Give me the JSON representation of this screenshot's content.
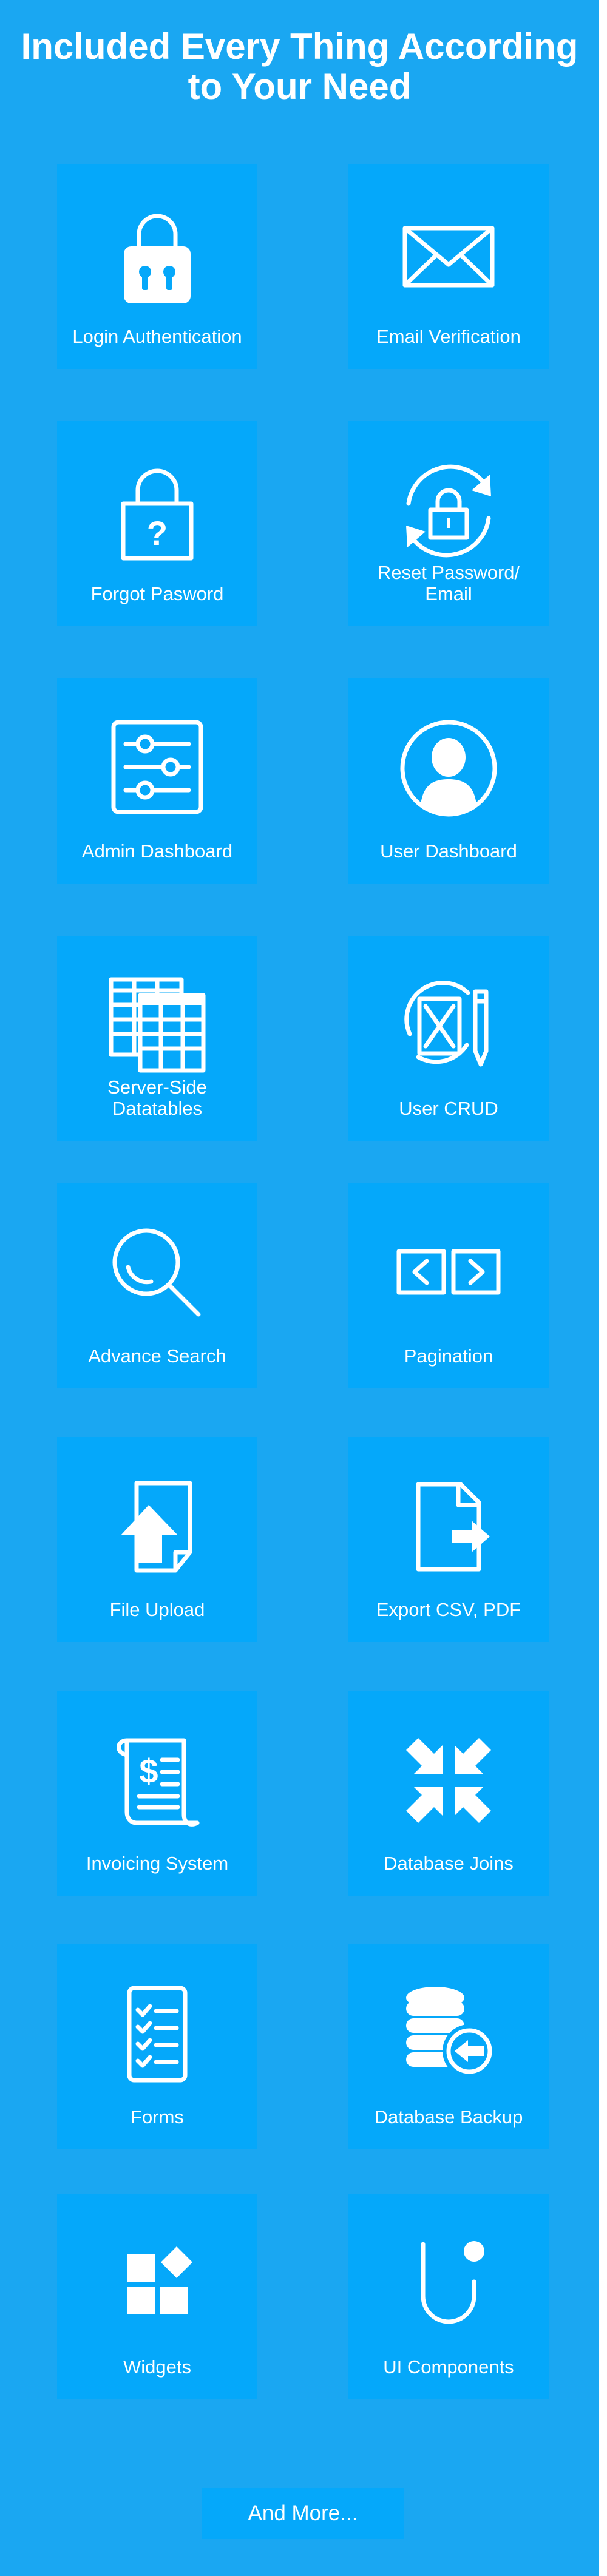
{
  "page": {
    "title": "Included Every Thing According to Your Need"
  },
  "features": [
    {
      "label": "Login Authentication",
      "icon": "lock-icon"
    },
    {
      "label": "Email Verification",
      "icon": "envelope-icon"
    },
    {
      "label": "Forgot Pasword",
      "icon": "lock-question-icon"
    },
    {
      "label": "Reset Password/\nEmail",
      "icon": "lock-refresh-icon"
    },
    {
      "label": "Admin Dashboard",
      "icon": "sliders-icon"
    },
    {
      "label": "User Dashboard",
      "icon": "user-avatar-icon"
    },
    {
      "label": "Server-Side\nDatatables",
      "icon": "spreadsheet-icon"
    },
    {
      "label": "User CRUD",
      "icon": "document-edit-icon"
    },
    {
      "label": "Advance Search",
      "icon": "magnifier-icon"
    },
    {
      "label": "Pagination",
      "icon": "prev-next-icon"
    },
    {
      "label": "File Upload",
      "icon": "file-upload-icon"
    },
    {
      "label": "Export CSV, PDF",
      "icon": "file-export-icon"
    },
    {
      "label": "Invoicing System",
      "icon": "invoice-icon"
    },
    {
      "label": "Database Joins",
      "icon": "arrows-in-icon"
    },
    {
      "label": "Forms",
      "icon": "checklist-icon"
    },
    {
      "label": "Database Backup",
      "icon": "database-restore-icon"
    },
    {
      "label": "Widgets",
      "icon": "widgets-icon"
    },
    {
      "label": "UI Components",
      "icon": "ui-logo-icon"
    }
  ],
  "more_button": {
    "label": "And More..."
  },
  "colors": {
    "background": "#1aa7f2",
    "tile": "#05a8fa",
    "text": "#ffffff"
  }
}
